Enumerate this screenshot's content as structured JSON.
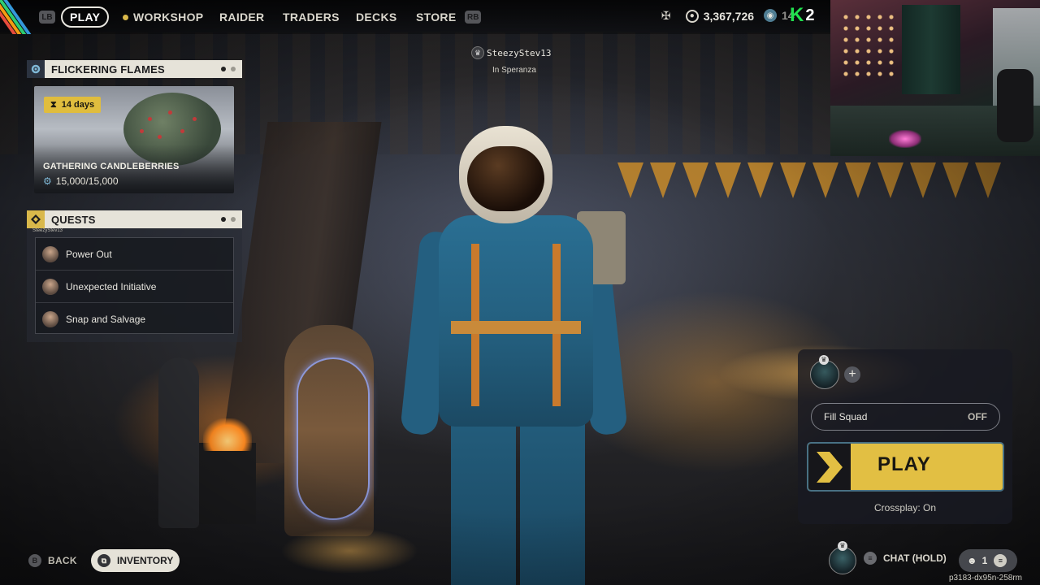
{
  "nav": {
    "lb": "LB",
    "rb": "RB",
    "items": [
      "PLAY",
      "WORKSHOP",
      "RAIDER",
      "TRADERS",
      "DECKS",
      "STORE"
    ],
    "active": "PLAY"
  },
  "currency": {
    "coins": "3,367,726",
    "tokens": "14"
  },
  "overlay": {
    "k_logo": "K",
    "k_number": "2"
  },
  "event": {
    "title": "FLICKERING FLAMES",
    "days_left": "14 days",
    "task_title": "GATHERING CANDLEBERRIES",
    "progress_text": "15,000/15,000",
    "progress_fraction": 1.0,
    "pager_active": 0,
    "pager_count": 2
  },
  "quests": {
    "title": "QUESTS",
    "tiny_name": "SteezyStev13",
    "items": [
      {
        "label": "Power Out",
        "icon": "quest-giver-avatar"
      },
      {
        "label": "Unexpected Initiative",
        "icon": "quest-giver-avatar"
      },
      {
        "label": "Snap and Salvage",
        "icon": "quest-giver-avatar"
      }
    ]
  },
  "user": {
    "name": "SteezyStev13",
    "location": "In Speranza"
  },
  "squad": {
    "fill_label": "Fill Squad",
    "fill_value": "OFF",
    "play_label": "PLAY",
    "crossplay": "Crossplay: On",
    "add_symbol": "+"
  },
  "bottom": {
    "back_key": "B",
    "back_label": "BACK",
    "inventory_label": "INVENTORY",
    "chat_label": "CHAT (HOLD)",
    "friends_count": "1",
    "build_id": "p3183-dx95n-258rm"
  },
  "colors": {
    "accent_yellow": "#e2bf43",
    "chip_yellow": "#e0bd3e",
    "panel_head": "#e6e3d9",
    "kick_green": "#22e04f"
  }
}
